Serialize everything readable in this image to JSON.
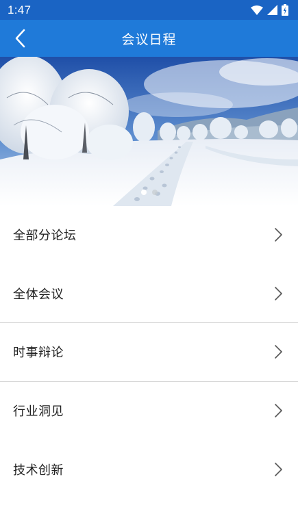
{
  "status_bar": {
    "time": "1:47",
    "icons": [
      "wifi-icon",
      "cell-signal-icon",
      "battery-icon"
    ]
  },
  "app_bar": {
    "title": "会议日程",
    "back_icon": "chevron-left-icon"
  },
  "banner": {
    "image": "snowy-forest-landscape",
    "slide_count": 2,
    "active_slide": 1
  },
  "menu": {
    "items": [
      {
        "label": "全部分论坛",
        "icon": "chevron-right-icon"
      },
      {
        "label": "全体会议",
        "icon": "chevron-right-icon"
      },
      {
        "label": "时事辩论",
        "icon": "chevron-right-icon"
      },
      {
        "label": "行业洞见",
        "icon": "chevron-right-icon"
      },
      {
        "label": "技术创新",
        "icon": "chevron-right-icon"
      }
    ]
  },
  "colors": {
    "status_bar": "#1a64c4",
    "app_bar": "#1f7ad9",
    "divider": "#d8d8d8",
    "text": "#222222"
  }
}
